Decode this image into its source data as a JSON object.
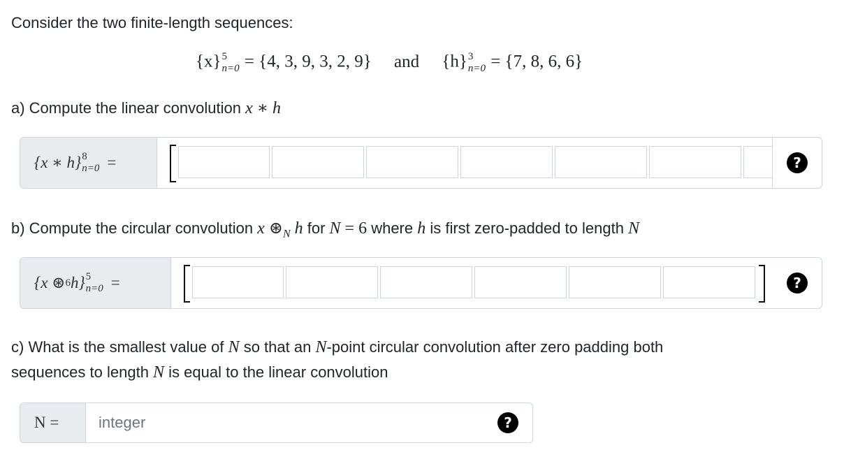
{
  "intro": "Consider the two finite-length sequences:",
  "sequences": {
    "x_name": "{x}",
    "x_sup": "5",
    "x_sub": "n=0",
    "x_value": "= {4, 3, 9, 3, 2, 9}",
    "and": "and",
    "h_name": "{h}",
    "h_sup": "3",
    "h_sub": "n=0",
    "h_value": "= {7, 8, 6, 6}"
  },
  "part_a": {
    "prompt_text": "a) Compute the linear convolution ",
    "prompt_math": "x ∗ h",
    "label_main": "{x ∗ h}",
    "label_sup": "8",
    "label_sub": "n=0",
    "label_eq": "="
  },
  "part_b": {
    "prompt_text1": "b) Compute the circular convolution ",
    "prompt_math1": "x ⊛",
    "prompt_math1_sub": "N",
    "prompt_math1_h": " h",
    "prompt_text2": " for ",
    "prompt_math2": "N",
    "prompt_math2b": " = 6",
    "prompt_text3": " where ",
    "prompt_math3": "h",
    "prompt_text4": " is first zero-padded to length ",
    "prompt_math4": "N",
    "label_main": "{x ⊛",
    "label_circ_sub": "6",
    "label_h": " h}",
    "label_sup": "5",
    "label_sub": "n=0",
    "label_eq": "="
  },
  "part_c": {
    "line1_a": "c) What is the smallest value of ",
    "line1_N": "N",
    "line1_b": " so that an ",
    "line1_N2": "N",
    "line1_c": "-point circular convolution after zero padding both",
    "line2_a": "sequences to length ",
    "line2_N": "N",
    "line2_b": " is equal to the linear convolution",
    "label": "N =",
    "placeholder": "integer"
  },
  "help_icon": "?"
}
